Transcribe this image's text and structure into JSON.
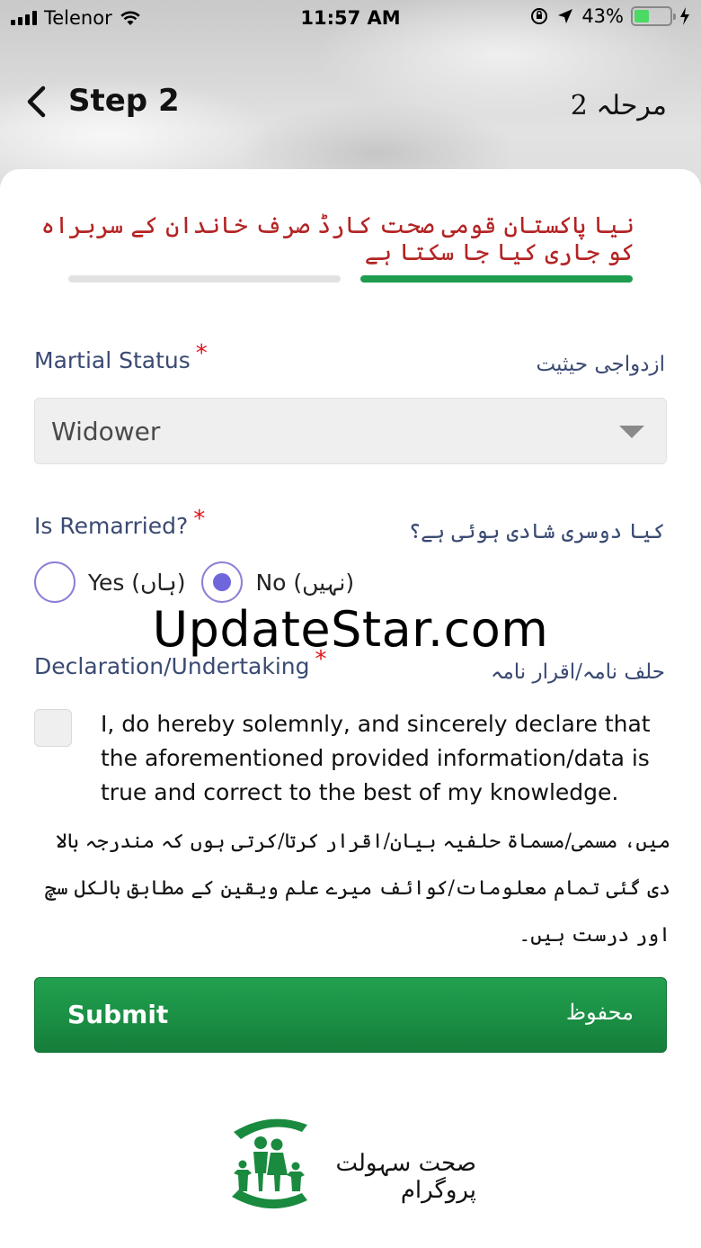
{
  "status_bar": {
    "carrier": "Telenor",
    "time": "11:57 AM",
    "battery_percent": "43%",
    "battery_level": 0.43,
    "battery_color": "#4cd964"
  },
  "nav": {
    "title": "Step 2",
    "title_urdu": "مرحلہ 2",
    "back_icon": "chevron-left-icon"
  },
  "notice": {
    "text": "نیا پاکستان قومی صحت کارڈ صرف خاندان کے سربراہ کو جاری کیا جا سکتا ہے",
    "color": "#b42323"
  },
  "progress": {
    "steps": 2,
    "current": 1,
    "active_color": "#1f9d4f",
    "inactive_color": "#e2e2e2"
  },
  "marital_status": {
    "label": "Martial Status",
    "required_mark": "*",
    "label_urdu": "ازدواجی حیثیت",
    "selected_value": "Widower"
  },
  "remarried": {
    "label": "Is Remarried?",
    "required_mark": "*",
    "label_urdu": "کیا دوسری شادی ہوئی ہے؟",
    "options": [
      {
        "label": "Yes (ہاں)",
        "checked": false
      },
      {
        "label": "No (نہیں)",
        "checked": true
      }
    ]
  },
  "watermark": "UpdateStar.com",
  "declaration": {
    "label": "Declaration/Undertaking",
    "required_mark": "*",
    "label_urdu": "حلف نامہ/اقرار نامہ",
    "checked": false,
    "text_en": "I, do hereby solemnly, and sincerely declare that the aforementioned provided information/data is true and correct to the best of my knowledge.",
    "text_ur": "میں، مسمی/مسماۃ حلفیہ بیان/اقرار کرتا/کرتی ہوں کہ مندرجہ بالا دی گئی تمام معلومات/کوائف میرے علم ویقین کے مطابق بالکل سچ اور درست ہیں۔"
  },
  "submit": {
    "label": "Submit",
    "label_urdu": "محفوظ",
    "color": "#1a8f44"
  },
  "footer": {
    "logo_text": "صحت سہولت پروگرام",
    "logo_color": "#1a8a3f"
  }
}
